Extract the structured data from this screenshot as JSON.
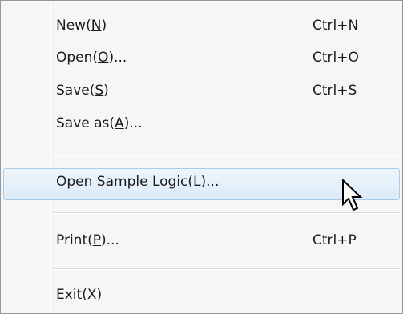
{
  "menu": {
    "items": [
      {
        "pre": "New(",
        "mnemonic": "N",
        "post": ")",
        "shortcut": "Ctrl+N"
      },
      {
        "pre": "Open(",
        "mnemonic": "O",
        "post": ")...",
        "shortcut": "Ctrl+O"
      },
      {
        "pre": "Save(",
        "mnemonic": "S",
        "post": ")",
        "shortcut": "Ctrl+S"
      },
      {
        "pre": "Save as(",
        "mnemonic": "A",
        "post": ")...",
        "shortcut": ""
      },
      {
        "pre": "Open Sample Logic(",
        "mnemonic": "L",
        "post": ")...",
        "shortcut": ""
      },
      {
        "pre": "Print(",
        "mnemonic": "P",
        "post": ")...",
        "shortcut": "Ctrl+P"
      },
      {
        "pre": "Exit(",
        "mnemonic": "X",
        "post": ")",
        "shortcut": ""
      }
    ],
    "highlighted_item": "Open Sample Logic(L)...",
    "cursor_icon": "arrow-pointer-icon"
  }
}
